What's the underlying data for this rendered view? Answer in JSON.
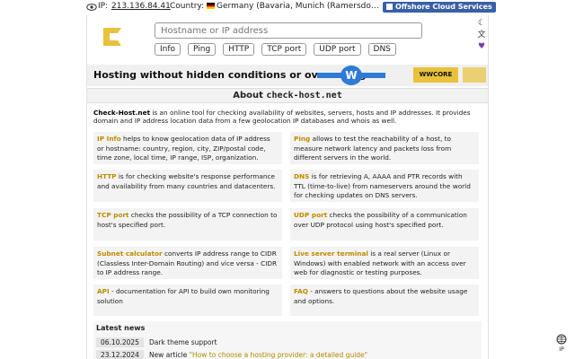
{
  "topbar": {
    "ip_label": "IP:",
    "ip_value": "213.136.84.41",
    "country_label": "Country:",
    "country_value": "Germany (Bavaria, Munich (Ramersdorf-Perla...",
    "offshore_label": "Offshore Cloud Services"
  },
  "header": {
    "search_placeholder": "Hostname or IP address",
    "buttons": [
      "Info",
      "Ping",
      "HTTP",
      "TCP port",
      "UDP port",
      "DNS"
    ],
    "icons": [
      "moon-icon",
      "translate-icon",
      "heart-icon"
    ]
  },
  "banner": {
    "text": "Hosting without hidden conditions or overselling",
    "w_letter": "W",
    "ww_text": "WWCORE"
  },
  "about": {
    "prefix": "About",
    "site": "check-host.net"
  },
  "intro": {
    "brand": "Check-Host.net",
    "text": " is an online tool for checking availability of websites, servers, hosts and IP addresses. It provides domain and IP address location data from a few geolocation IP databases and whois as well."
  },
  "cards": [
    {
      "key": "IP Info",
      "text": " helps to know geolocation data of IP address or hostname: country, region, city, ZIP/postal code, time zone, local time, IP range, ISP, organization."
    },
    {
      "key": "Ping",
      "text": " allows to test the reachability of a host, to measure network latency and packets loss from different servers in the world."
    },
    {
      "key": "HTTP",
      "text": " is for checking website's response performance and availability from many countries and datacenters."
    },
    {
      "key": "DNS",
      "text": " is for retrieving A, AAAA and PTR records with TTL (time-to-live) from nameservers around the world for checking updates on DNS servers."
    },
    {
      "key": "TCP port",
      "text": " checks the possibility of a TCP connection to host's specified port."
    },
    {
      "key": "UDP port",
      "text": " checks the possibility of a communication over UDP protocol using host's specified port."
    },
    {
      "key": "Subnet calculator",
      "text": " converts IP address range to CIDR (Classless Inter-Domain Routing) and vice versa - CIDR to IP address range."
    },
    {
      "key": "Live server terminal",
      "text": " is a real server (Linux or Windows) with enabled network with an access over web for diagnostic or testing purposes."
    },
    {
      "key": "API",
      "text": " - documentation for API to build own monitoring solution"
    },
    {
      "key": "FAQ",
      "text": " - answers to questions about the website usage and options."
    }
  ],
  "news": {
    "title": "Latest news",
    "items": [
      {
        "date": "06.10.2025",
        "prefix": "",
        "text": "Dark theme support",
        "link": ""
      },
      {
        "date": "23.12.2024",
        "prefix": "New article ",
        "text": "",
        "link": "\"How to choose a hosting provider: a detailed guide\""
      }
    ]
  },
  "side": {
    "ip_label": "IP"
  },
  "colors": {
    "accent": "#c08a00",
    "brand_blue": "#3a5fa6",
    "logo": "#e8c23a"
  }
}
